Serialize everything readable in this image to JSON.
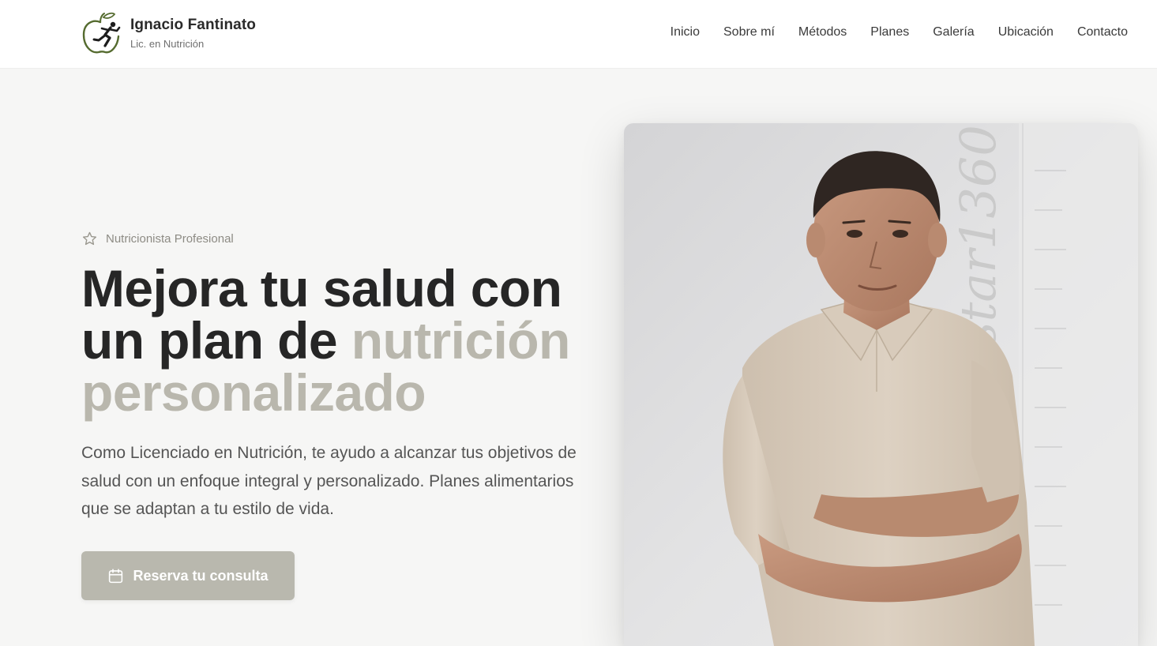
{
  "brand": {
    "name": "Ignacio Fantinato",
    "subtitle": "Lic. en Nutrición",
    "logo": "apple-runner-logo"
  },
  "nav": {
    "items": [
      {
        "label": "Inicio"
      },
      {
        "label": "Sobre mí"
      },
      {
        "label": "Métodos"
      },
      {
        "label": "Planes"
      },
      {
        "label": "Galería"
      },
      {
        "label": "Ubicación"
      },
      {
        "label": "Contacto"
      }
    ]
  },
  "hero": {
    "eyebrow_icon": "star-icon",
    "eyebrow": "Nutricionista Profesional",
    "title_part1": "Mejora tu salud con un plan de ",
    "title_accent": "nutrición personalizado",
    "description": "Como Licenciado en Nutrición, te ayudo a alcanzar tus objetivos de salud con un enfoque integral y personalizado. Planes alimentarios que se adaptan a tu estilo de vida.",
    "cta_icon": "calendar-icon",
    "cta_label": "Reserva tu consulta",
    "photo_watermark": "estar1360"
  },
  "colors": {
    "accent": "#b9b7ad",
    "button": "#b9b8ae",
    "background": "#f6f6f5",
    "text": "#262626"
  }
}
